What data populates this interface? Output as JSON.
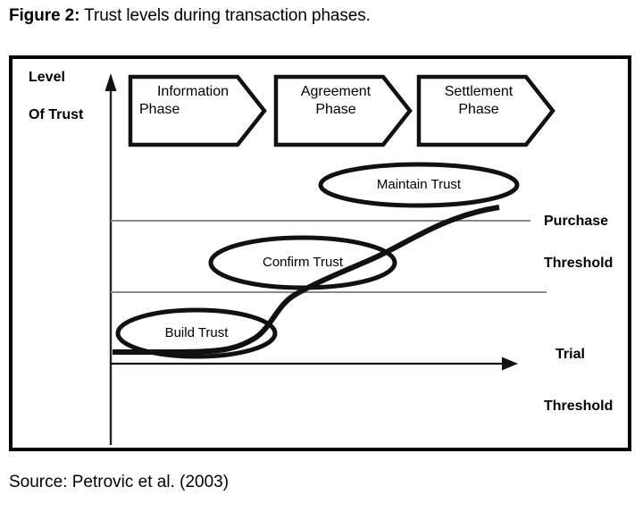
{
  "caption": {
    "prefix": "Figure 2:",
    "text": " Trust levels during transaction phases."
  },
  "source": {
    "text": "Source: Petrovic et al. (2003)"
  },
  "axis": {
    "y_label_line1": "Level",
    "y_label_line2": "Of Trust"
  },
  "thresholds": {
    "purchase_line1": "Purchase",
    "purchase_line2": "Threshold",
    "trial_line1": "Trial",
    "trial_line2": "Threshold"
  },
  "phases": [
    {
      "line1": "Information",
      "line2": "Phase"
    },
    {
      "line1": "Agreement",
      "line2": "Phase"
    },
    {
      "line1": "Settlement",
      "line2": "Phase"
    }
  ],
  "stages": [
    {
      "label": "Build Trust"
    },
    {
      "label": "Confirm Trust"
    },
    {
      "label": "Maintain Trust"
    }
  ],
  "colors": {
    "frame": "#000000",
    "curve": "#000000",
    "threshold_line": "#808080",
    "text": "#000000",
    "background": "#ffffff"
  },
  "chart_data": {
    "type": "line",
    "title": "Trust levels during transaction phases.",
    "xlabel": "",
    "ylabel": "Level Of Trust",
    "grid": false,
    "legend": "none",
    "annotations": [
      "Information Phase",
      "Agreement Phase",
      "Settlement Phase",
      "Build Trust",
      "Confirm Trust",
      "Maintain Trust",
      "Purchase Threshold",
      "Trial Threshold"
    ],
    "reference_lines": [
      {
        "name": "Purchase Threshold",
        "level": 3
      },
      {
        "name": "Trial Threshold",
        "level": 1
      }
    ],
    "series": [
      {
        "name": "Trust level",
        "x": [
          0,
          1,
          2,
          3,
          4,
          5
        ],
        "values": [
          1,
          1,
          2,
          3,
          4,
          4
        ]
      }
    ]
  }
}
